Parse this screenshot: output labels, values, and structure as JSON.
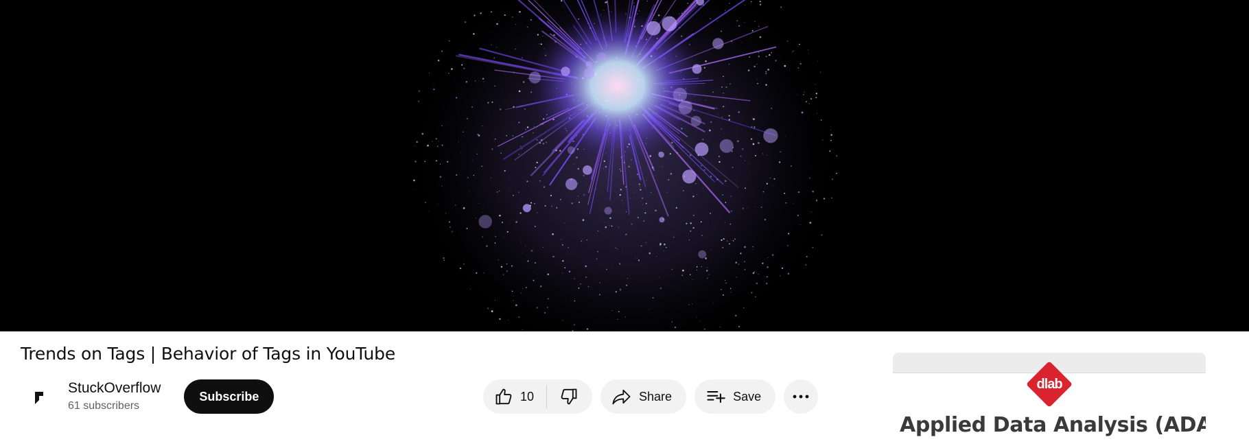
{
  "video": {
    "title": "Trends on Tags | Behavior of Tags in YouTube"
  },
  "channel": {
    "name": "StuckOverflow",
    "subscribers": "61 subscribers",
    "subscribe_label": "Subscribe"
  },
  "actions": {
    "like_count": "10",
    "share_label": "Share",
    "save_label": "Save",
    "icons": {
      "like": "thumbs-up-icon",
      "dislike": "thumbs-down-icon",
      "share": "share-arrow-icon",
      "save": "playlist-add-icon",
      "more": "more-horizontal-icon"
    }
  },
  "side_card": {
    "logo_text": "dlab",
    "title": "Applied Data Analysis (ADA)"
  },
  "colors": {
    "player_background": "#000000",
    "subscribe_background": "#0f0f0f",
    "pill_background": "#f2f2f2",
    "dlab_red": "#d9232e"
  }
}
